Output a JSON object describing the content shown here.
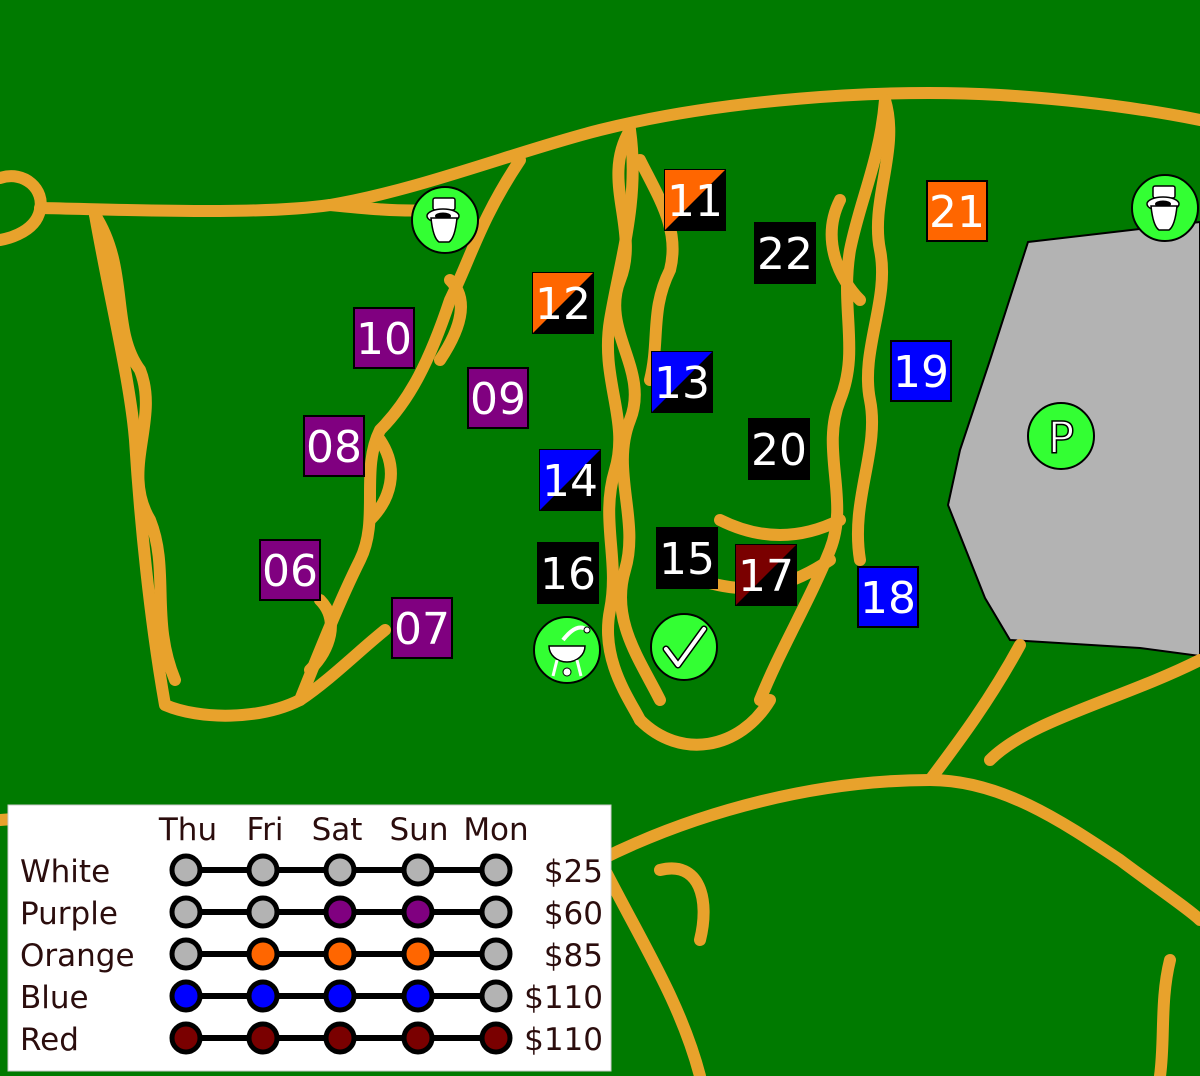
{
  "map": {
    "sites": [
      {
        "num": "06",
        "fill": "#800080"
      },
      {
        "num": "07",
        "fill": "#800080"
      },
      {
        "num": "08",
        "fill": "#800080"
      },
      {
        "num": "09",
        "fill": "#800080"
      },
      {
        "num": "10",
        "fill": "#800080"
      },
      {
        "num": "11",
        "fill": "#ff6600",
        "fill2": "#000000"
      },
      {
        "num": "12",
        "fill": "#ff6600",
        "fill2": "#000000"
      },
      {
        "num": "13",
        "fill": "#0000ff",
        "fill2": "#000000"
      },
      {
        "num": "14",
        "fill": "#0000ff",
        "fill2": "#000000"
      },
      {
        "num": "15",
        "fill": "#000000"
      },
      {
        "num": "16",
        "fill": "#000000"
      },
      {
        "num": "17",
        "fill": "#7a0000",
        "fill2": "#000000"
      },
      {
        "num": "18",
        "fill": "#0000ff"
      },
      {
        "num": "19",
        "fill": "#0000ff"
      },
      {
        "num": "20",
        "fill": "#000000"
      },
      {
        "num": "21",
        "fill": "#ff6600"
      },
      {
        "num": "22",
        "fill": "#000000"
      }
    ],
    "amenities": [
      {
        "icon": "toilet-icon"
      },
      {
        "icon": "toilet-icon"
      },
      {
        "icon": "parking-icon",
        "label": "P"
      },
      {
        "icon": "grill-icon"
      },
      {
        "icon": "checkmark-icon"
      }
    ],
    "colors": {
      "grass": "#007a00",
      "trail": "#e8a22c",
      "parking_lot": "#b3b3b3",
      "amenity_circle": "#33ff33"
    }
  },
  "legend": {
    "days": [
      "Thu",
      "Fri",
      "Sat",
      "Sun",
      "Mon"
    ],
    "rows": [
      {
        "name": "White",
        "price": "$25",
        "dots": [
          "#b3b3b3",
          "#b3b3b3",
          "#b3b3b3",
          "#b3b3b3",
          "#b3b3b3"
        ]
      },
      {
        "name": "Purple",
        "price": "$60",
        "dots": [
          "#b3b3b3",
          "#b3b3b3",
          "#800080",
          "#800080",
          "#b3b3b3"
        ]
      },
      {
        "name": "Orange",
        "price": "$85",
        "dots": [
          "#b3b3b3",
          "#ff6600",
          "#ff6600",
          "#ff6600",
          "#b3b3b3"
        ]
      },
      {
        "name": "Blue",
        "price": "$110",
        "dots": [
          "#0000ff",
          "#0000ff",
          "#0000ff",
          "#0000ff",
          "#b3b3b3"
        ]
      },
      {
        "name": "Red",
        "price": "$110",
        "dots": [
          "#7a0000",
          "#7a0000",
          "#7a0000",
          "#7a0000",
          "#7a0000"
        ]
      }
    ]
  }
}
